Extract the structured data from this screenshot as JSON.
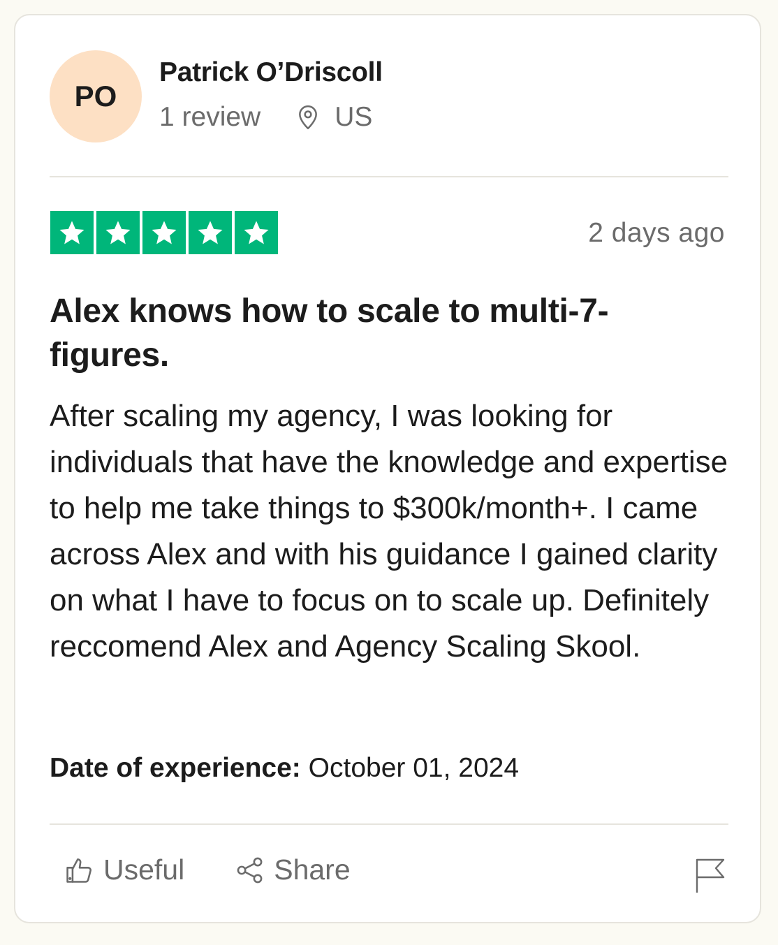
{
  "reviewer": {
    "initials": "PO",
    "name": "Patrick O’Driscoll",
    "review_count": "1 review",
    "country": "US",
    "avatar_color": "#fde0c4"
  },
  "rating": {
    "stars": 5,
    "max_stars": 5,
    "star_color": "#00b67a"
  },
  "review": {
    "date": "2 days ago",
    "title": "Alex knows how to scale to multi-7-figures.",
    "body": "After scaling my agency, I was looking for individuals that have the knowledge and expertise to help me take things to $300k/month+. I came across Alex and with his guidance I gained clarity on what I have to focus on to scale up. Definitely reccomend Alex and Agency Scaling Skool.",
    "experience_label": "Date of experience:",
    "experience_date": "October 01, 2024"
  },
  "actions": {
    "useful_label": "Useful",
    "share_label": "Share",
    "useful_icon": "thumbs-up-icon",
    "share_icon": "share-icon",
    "flag_icon": "flag-icon",
    "location_icon": "location-pin-icon"
  }
}
